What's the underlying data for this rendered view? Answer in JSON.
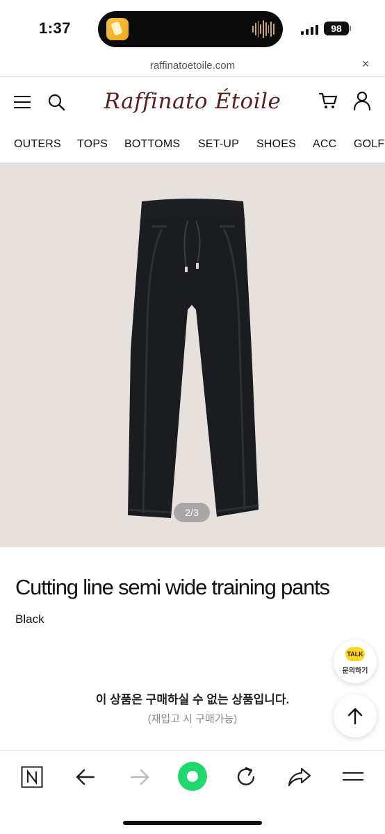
{
  "status_bar": {
    "time": "1:37",
    "battery": "98"
  },
  "browser": {
    "url": "raffinatoetoile.com",
    "close_symbol": "×"
  },
  "site": {
    "logo_text": "Raffinato Étoile",
    "nav": [
      "OUTERS",
      "TOPS",
      "BOTTOMS",
      "SET-UP",
      "SHOES",
      "ACC",
      "GOLF"
    ]
  },
  "product": {
    "image_counter": "2/3",
    "title": "Cutting line semi wide training pants",
    "color": "Black",
    "unavailable_message": "이 상품은 구매하실 수 없는 상품입니다.",
    "restock_note": "(재입고 시 구매가능)"
  },
  "floating": {
    "kakao_badge": "TALK",
    "kakao_label": "문의하기"
  },
  "icons": {
    "menu": "menu-icon",
    "search": "search-icon",
    "cart": "cart-icon",
    "account": "account-icon",
    "back": "arrow-left-icon",
    "forward": "arrow-right-icon",
    "reload": "reload-icon",
    "share": "share-icon",
    "tabs": "hamburger-icon",
    "naver": "naver-n-icon",
    "top": "arrow-up-icon"
  },
  "colors": {
    "logo": "#5a1f1f",
    "image_background": "#e6e1dd",
    "record_button": "#1fd96c",
    "kakao_yellow": "#f9d71c"
  }
}
